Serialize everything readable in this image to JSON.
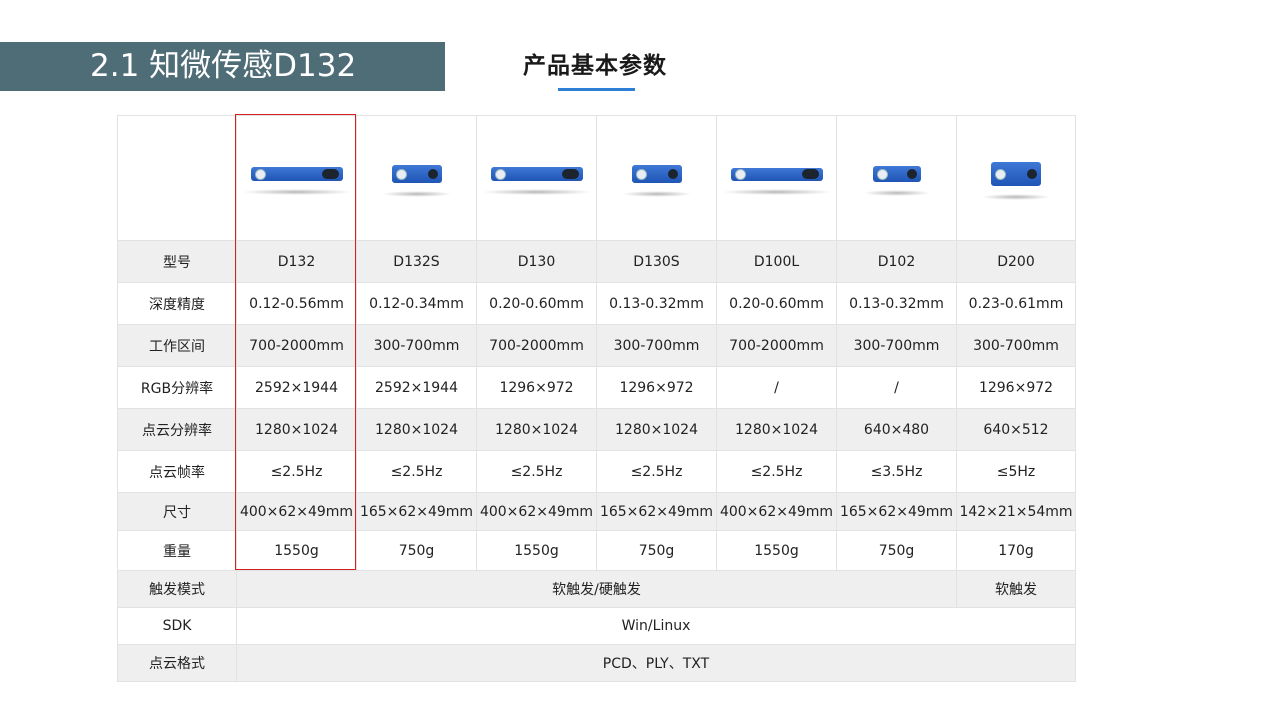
{
  "header": {
    "banner_title": "2.1 知微传感D132",
    "section_title": "产品基本参数"
  },
  "colors": {
    "banner_bg": "#4f6d76",
    "accent": "#2e7fd6",
    "highlight": "#d32020",
    "product_blue": "#2f66c8"
  },
  "products": [
    "D132",
    "D132S",
    "D130",
    "D130S",
    "D100L",
    "D102",
    "D200"
  ],
  "rows": [
    {
      "label": "型号",
      "values": [
        "D132",
        "D132S",
        "D130",
        "D130S",
        "D100L",
        "D102",
        "D200"
      ]
    },
    {
      "label": "深度精度",
      "values": [
        "0.12-0.56mm",
        "0.12-0.34mm",
        "0.20-0.60mm",
        "0.13-0.32mm",
        "0.20-0.60mm",
        "0.13-0.32mm",
        "0.23-0.61mm"
      ]
    },
    {
      "label": "工作区间",
      "values": [
        "700-2000mm",
        "300-700mm",
        "700-2000mm",
        "300-700mm",
        "700-2000mm",
        "300-700mm",
        "300-700mm"
      ]
    },
    {
      "label": "RGB分辨率",
      "values": [
        "2592×1944",
        "2592×1944",
        "1296×972",
        "1296×972",
        "/",
        "/",
        "1296×972"
      ]
    },
    {
      "label": "点云分辨率",
      "values": [
        "1280×1024",
        "1280×1024",
        "1280×1024",
        "1280×1024",
        "1280×1024",
        "640×480",
        "640×512"
      ]
    },
    {
      "label": "点云帧率",
      "values": [
        "≤2.5Hz",
        "≤2.5Hz",
        "≤2.5Hz",
        "≤2.5Hz",
        "≤2.5Hz",
        "≤3.5Hz",
        "≤5Hz"
      ]
    },
    {
      "label": "尺寸",
      "values": [
        "400×62×49mm",
        "165×62×49mm",
        "400×62×49mm",
        "165×62×49mm",
        "400×62×49mm",
        "165×62×49mm",
        "142×21×54mm"
      ]
    },
    {
      "label": "重量",
      "values": [
        "1550g",
        "750g",
        "1550g",
        "750g",
        "1550g",
        "750g",
        "170g"
      ]
    }
  ],
  "trigger": {
    "label": "触发模式",
    "shared": "软触发/硬触发",
    "last": "软触发"
  },
  "sdk": {
    "label": "SDK",
    "value": "Win/Linux"
  },
  "pointcloud_format": {
    "label": "点云格式",
    "value": "PCD、PLY、TXT"
  }
}
